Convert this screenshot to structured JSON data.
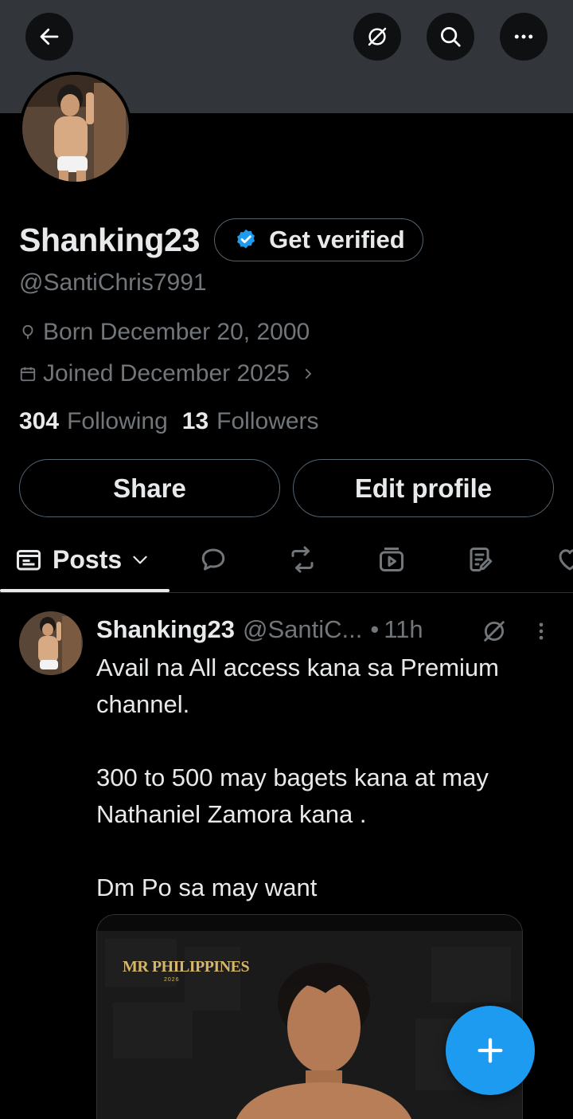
{
  "header": {
    "back_icon": "arrow-left-icon",
    "grok_icon": "grok-icon",
    "search_icon": "search-icon",
    "more_icon": "more-horizontal-icon"
  },
  "profile": {
    "display_name": "Shanking23",
    "get_verified_label": "Get verified",
    "handle": "@SantiChris7991",
    "born": "Born December 20, 2000",
    "joined": "Joined December 2025",
    "following_count": "304",
    "following_label": "Following",
    "followers_count": "13",
    "followers_label": "Followers"
  },
  "actions": {
    "share_label": "Share",
    "edit_label": "Edit profile"
  },
  "tabs": {
    "posts_label": "Posts",
    "icons": [
      "posts-icon",
      "replies-icon",
      "reposts-icon",
      "videos-icon",
      "articles-icon",
      "likes-icon"
    ]
  },
  "post": {
    "name": "Shanking23",
    "handle": "@SantiC...",
    "separator": "•",
    "time": "11h",
    "line1": "Avail na All access kana sa Premium channel.",
    "line2": "300 to 500 may bagets kana at may Nathaniel Zamora kana .",
    "line3": "Dm Po sa may want",
    "media_logo_text": "MR PHILIPPINES",
    "media_logo_year": "2026"
  },
  "colors": {
    "accent": "#1d9bf0",
    "banner": "#323539",
    "muted": "#71767b"
  }
}
